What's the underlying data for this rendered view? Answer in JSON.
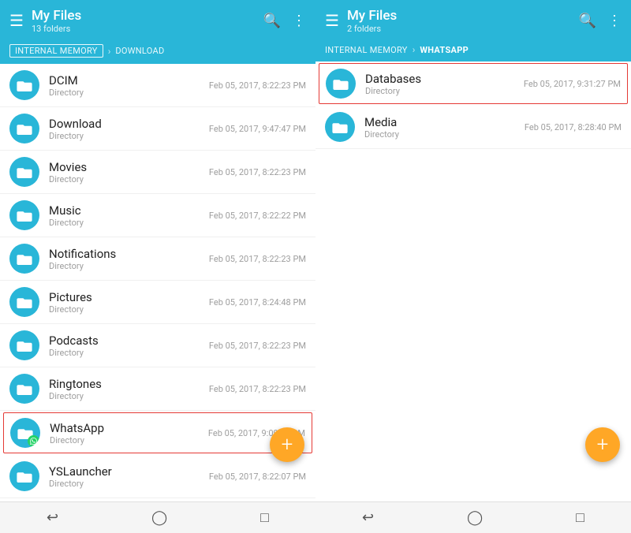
{
  "colors": {
    "header_bg": "#29b6d8",
    "fab_bg": "#ffa726",
    "selected_border": "#e53935",
    "folder_icon_bg": "#29b6d8",
    "whatsapp_green": "#25d366"
  },
  "left_panel": {
    "title": "My Files",
    "subtitle": "13 folders",
    "breadcrumb": [
      {
        "label": "INTERNAL MEMORY",
        "active": true
      },
      {
        "label": "DOWNLOAD",
        "active": false
      }
    ],
    "files": [
      {
        "name": "DCIM",
        "type": "Directory",
        "date": "Feb 05, 2017, 8:22:23 PM",
        "selected": false,
        "whatsapp": false
      },
      {
        "name": "Download",
        "type": "Directory",
        "date": "Feb 05, 2017, 9:47:47 PM",
        "selected": false,
        "whatsapp": false
      },
      {
        "name": "Movies",
        "type": "Directory",
        "date": "Feb 05, 2017, 8:22:23 PM",
        "selected": false,
        "whatsapp": false
      },
      {
        "name": "Music",
        "type": "Directory",
        "date": "Feb 05, 2017, 8:22:22 PM",
        "selected": false,
        "whatsapp": false
      },
      {
        "name": "Notifications",
        "type": "Directory",
        "date": "Feb 05, 2017, 8:22:23 PM",
        "selected": false,
        "whatsapp": false
      },
      {
        "name": "Pictures",
        "type": "Directory",
        "date": "Feb 05, 2017, 8:24:48 PM",
        "selected": false,
        "whatsapp": false
      },
      {
        "name": "Podcasts",
        "type": "Directory",
        "date": "Feb 05, 2017, 8:22:23 PM",
        "selected": false,
        "whatsapp": false
      },
      {
        "name": "Ringtones",
        "type": "Directory",
        "date": "Feb 05, 2017, 8:22:23 PM",
        "selected": false,
        "whatsapp": false
      },
      {
        "name": "WhatsApp",
        "type": "Directory",
        "date": "Feb 05, 2017, 9:09:21 PM",
        "selected": true,
        "whatsapp": true
      },
      {
        "name": "YSLauncher",
        "type": "Directory",
        "date": "Feb 05, 2017, 8:22:07 PM",
        "selected": false,
        "whatsapp": false
      }
    ],
    "fab_label": "+",
    "bottom_nav": [
      "↩",
      "○",
      "□"
    ]
  },
  "right_panel": {
    "title": "My Files",
    "subtitle": "2 folders",
    "breadcrumb": [
      {
        "label": "INTERNAL MEMORY",
        "active": false
      },
      {
        "label": "WHATSAPP",
        "active": false,
        "bold": true
      }
    ],
    "files": [
      {
        "name": "Databases",
        "type": "Directory",
        "date": "Feb 05, 2017, 9:31:27 PM",
        "selected": true,
        "whatsapp": false
      },
      {
        "name": "Media",
        "type": "Directory",
        "date": "Feb 05, 2017, 8:28:40 PM",
        "selected": false,
        "whatsapp": false
      }
    ],
    "fab_label": "+",
    "bottom_nav": [
      "↩",
      "○",
      "□"
    ]
  }
}
